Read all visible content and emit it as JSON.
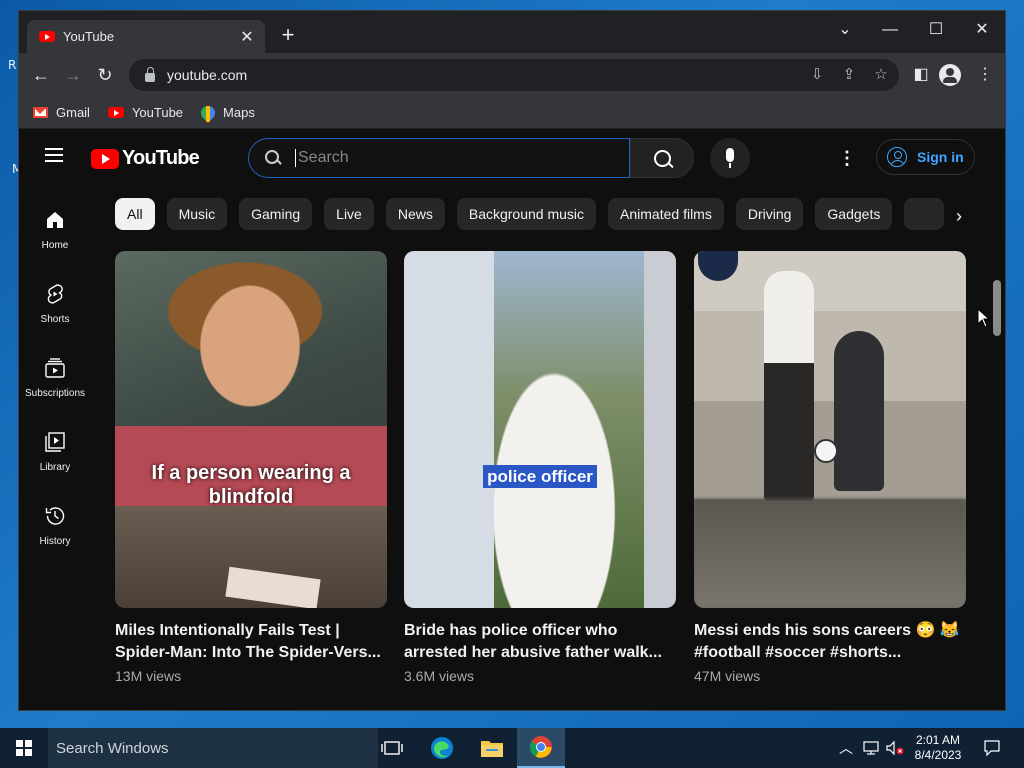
{
  "desktop": {
    "side_letters": [
      "R",
      "M"
    ]
  },
  "browser": {
    "tab_title": "YouTube",
    "url": "youtube.com",
    "bookmarks": [
      {
        "label": "Gmail",
        "icon": "gmail-icon"
      },
      {
        "label": "YouTube",
        "icon": "youtube-icon"
      },
      {
        "label": "Maps",
        "icon": "maps-icon"
      }
    ]
  },
  "youtube": {
    "logo_text": "YouTube",
    "search_placeholder": "Search",
    "sign_in": "Sign in",
    "chips": [
      "All",
      "Music",
      "Gaming",
      "Live",
      "News",
      "Background music",
      "Animated films",
      "Driving",
      "Gadgets"
    ],
    "sidebar": [
      {
        "label": "Home",
        "icon": "home-icon"
      },
      {
        "label": "Shorts",
        "icon": "shorts-icon"
      },
      {
        "label": "Subscriptions",
        "icon": "subscriptions-icon"
      },
      {
        "label": "Library",
        "icon": "library-icon"
      },
      {
        "label": "History",
        "icon": "history-icon"
      }
    ],
    "videos": [
      {
        "title": "Miles Intentionally Fails Test | Spider-Man: Into The Spider-Vers...",
        "views": "13M views",
        "overlay": "If a person wearing a blindfold"
      },
      {
        "title": "Bride has police officer who arrested her abusive father walk...",
        "views": "3.6M views",
        "overlay": "police officer"
      },
      {
        "title": "Messi ends his sons careers 😳 😹 #football #soccer #shorts...",
        "views": "47M views",
        "overlay": ""
      }
    ]
  },
  "taskbar": {
    "search_placeholder": "Search Windows",
    "time": "2:01 AM",
    "date": "8/4/2023"
  },
  "colors": {
    "youtube_red": "#ff0000",
    "link_blue": "#3ea6ff",
    "bg": "#0f0f0f"
  }
}
